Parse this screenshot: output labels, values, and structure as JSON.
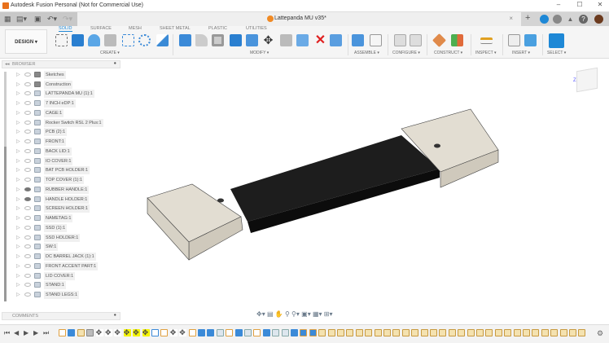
{
  "window": {
    "title": "Autodesk Fusion Personal (Not for Commercial Use)",
    "minimize": "–",
    "maximize": "☐",
    "close": "✕"
  },
  "document": {
    "name": "Lattepanda MU v35*",
    "close": "×",
    "new_tab": "+"
  },
  "quick_access": {
    "grid": "▦",
    "file": "▤▾",
    "save": "▣",
    "undo": "↶▾",
    "redo": "↷▾"
  },
  "workspace": {
    "label": "DESIGN ▾"
  },
  "toolbar_tabs": [
    "SOLID",
    "SURFACE",
    "MESH",
    "SHEET METAL",
    "PLASTIC",
    "UTILITIES"
  ],
  "tool_groups": [
    "CREATE ▾",
    "MODIFY ▾",
    "ASSEMBLE ▾",
    "CONFIGURE ▾",
    "CONSTRUCT ▾",
    "INSPECT ▾",
    "INSERT ▾",
    "SELECT ▾"
  ],
  "browser": {
    "title": "BROWSER",
    "items": [
      {
        "label": "Sketches",
        "icon": "folder",
        "visible": false
      },
      {
        "label": "Construction",
        "icon": "folder",
        "visible": false
      },
      {
        "label": "LATTEPANDA MU (1):1",
        "icon": "component",
        "visible": false
      },
      {
        "label": "7 INCH eDP:1",
        "icon": "body",
        "visible": false
      },
      {
        "label": "CAGE:1",
        "icon": "component",
        "visible": false
      },
      {
        "label": "Rocker Switch RSL 2 Plus:1",
        "icon": "body",
        "visible": false
      },
      {
        "label": "PCB (2):1",
        "icon": "body",
        "visible": false
      },
      {
        "label": "FRONT:1",
        "icon": "body",
        "visible": false
      },
      {
        "label": "BACK LID:1",
        "icon": "body",
        "visible": false
      },
      {
        "label": "IO COVER:1",
        "icon": "body",
        "visible": false
      },
      {
        "label": "BAT PCB HOLDER:1",
        "icon": "body",
        "visible": false
      },
      {
        "label": "TOP COVER (1):1",
        "icon": "body",
        "visible": false
      },
      {
        "label": "RUBBER HANDLE:1",
        "icon": "body",
        "visible": true
      },
      {
        "label": "HANDLE HOLDER:1",
        "icon": "body",
        "visible": true
      },
      {
        "label": "SCREEN HOLDER:1",
        "icon": "body",
        "visible": false
      },
      {
        "label": "NAMETAG:1",
        "icon": "body",
        "visible": false
      },
      {
        "label": "SSD (1):1",
        "icon": "component",
        "visible": false
      },
      {
        "label": "SSD HOLDER:1",
        "icon": "component",
        "visible": false
      },
      {
        "label": "SW:1",
        "icon": "body",
        "visible": false
      },
      {
        "label": "DC BARREL JACK (1):1",
        "icon": "body",
        "visible": false
      },
      {
        "label": "FRONT ACCENT PART:1",
        "icon": "body",
        "visible": false
      },
      {
        "label": "LID COVER:1",
        "icon": "body",
        "visible": false
      },
      {
        "label": "STAND:1",
        "icon": "body",
        "visible": false
      },
      {
        "label": "STAND LEGS:1",
        "icon": "body",
        "visible": false
      }
    ]
  },
  "comments": {
    "title": "COMMENTS"
  },
  "timeline": {
    "controls": [
      "⏮",
      "◀",
      "▶",
      "▶",
      "⏭"
    ],
    "items": [
      "s",
      "b",
      "o",
      "g",
      "m",
      "m",
      "m",
      "M",
      "M",
      "M",
      "p",
      "s",
      "m",
      "m",
      "s",
      "b",
      "b",
      "f",
      "s",
      "b",
      "f",
      "s",
      "b",
      "f",
      "f",
      "b",
      "c",
      "c",
      "o",
      "o",
      "o",
      "o",
      "o",
      "o",
      "o",
      "o",
      "o",
      "o",
      "o",
      "o",
      "o",
      "o",
      "o",
      "o",
      "o",
      "o",
      "o",
      "o",
      "o",
      "o",
      "o",
      "o",
      "o",
      "o",
      "o",
      "o",
      "o"
    ]
  },
  "colors": {
    "accent": "#1e88d6",
    "block": "#e2ddd2",
    "handle": "#1f1f1f",
    "highlight": "#f4f400"
  }
}
